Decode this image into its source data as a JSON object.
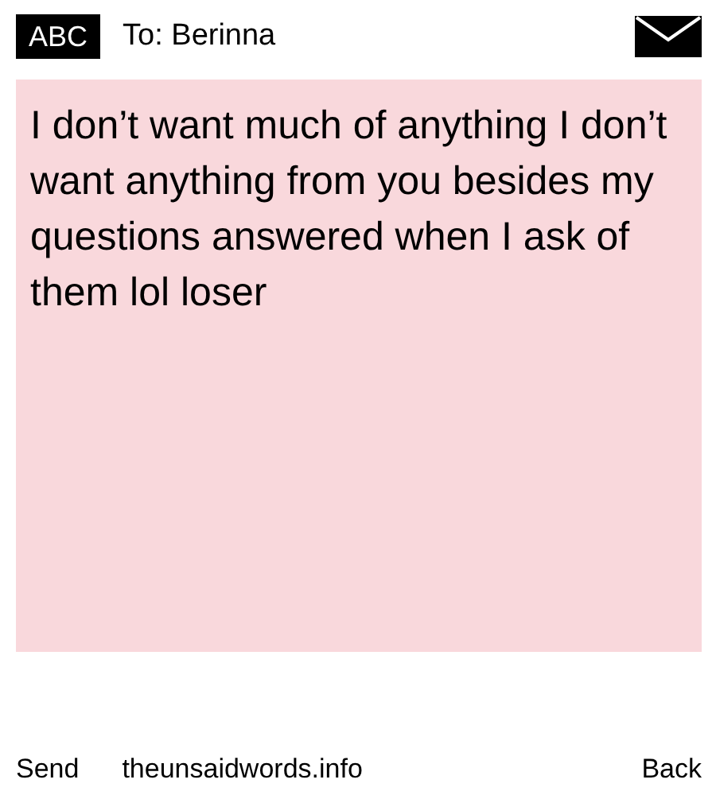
{
  "header": {
    "mode_badge": "ABC",
    "recipient": "To: Berinna"
  },
  "message": {
    "text": "I don’t want much of anything I don’t want anything from you besides my questions answered when I ask of them lol loser"
  },
  "footer": {
    "left_action": "Send",
    "site": "theunsaidwords.info",
    "right_action": "Back"
  }
}
